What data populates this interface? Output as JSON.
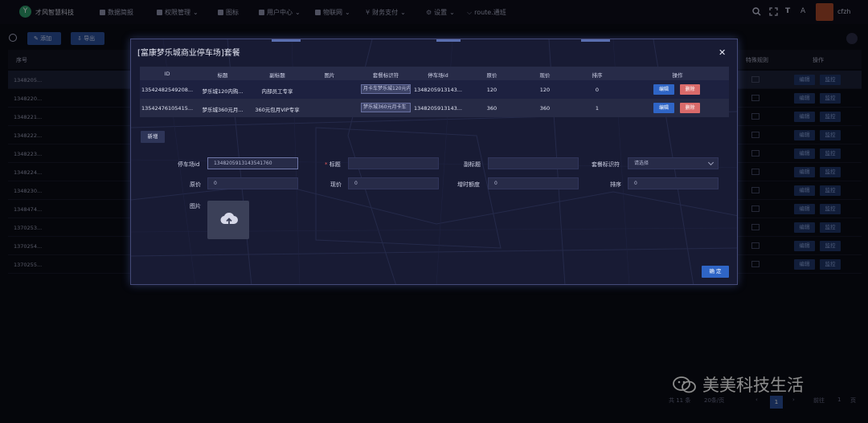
{
  "header": {
    "brand": "才风智慧科技",
    "nav": [
      {
        "label": "数据简报",
        "icon": "dashboard-icon"
      },
      {
        "label": "权限管理",
        "icon": "lock-icon",
        "dropdown": true
      },
      {
        "label": "图标",
        "icon": "image-icon"
      },
      {
        "label": "用户中心",
        "icon": "user-icon",
        "dropdown": true
      },
      {
        "label": "物联网",
        "icon": "iot-icon",
        "dropdown": true
      },
      {
        "label": "财务支付",
        "icon": "yen-icon",
        "dropdown": true
      },
      {
        "label": "设置",
        "icon": "settings-icon",
        "dropdown": true
      },
      {
        "label": "route.通班",
        "icon": "route-icon"
      }
    ],
    "user": "cfzh"
  },
  "background": {
    "toolbar": {
      "add_label": "添加",
      "export_label": "导出"
    },
    "table_headers": {
      "serial": "序号",
      "special_rule": "特殊规则",
      "ops": "操作"
    },
    "row_ids": [
      "1348205...",
      "1348220...",
      "1348221...",
      "1348222...",
      "1348223...",
      "1348224...",
      "1348230...",
      "1348474...",
      "1370253...",
      "1370254...",
      "1370255..."
    ],
    "row_edit": "编辑",
    "row_monitor": "监控",
    "pagination": {
      "total": "共 11 条",
      "page_size": "20条/页",
      "current": "1",
      "goto_label": "前往",
      "goto_value": "1",
      "page_unit": "页"
    }
  },
  "watermark": "美美科技生活",
  "modal": {
    "title": "[富康梦乐城商业停车场]套餐",
    "sub_table": {
      "headers": [
        "ID",
        "标题",
        "副标题",
        "图片",
        "套餐标识符",
        "停车场id",
        "原价",
        "现价",
        "排序",
        "操作"
      ],
      "rows": [
        {
          "id": "13542482549208...",
          "title": "梦乐城120内购...",
          "subtitle": "内部员工专享",
          "image": "",
          "identifier": "月卡车梦乐城120元内部专享",
          "lot_id": "13482059131​43...",
          "original_price": "120",
          "current_price": "120",
          "sort": "0"
        },
        {
          "id": "13542476105415...",
          "title": "梦乐城360元月...",
          "subtitle": "360元包月VIP专享",
          "image": "",
          "identifier": "梦乐城360元月卡车",
          "lot_id": "13482059131​43...",
          "original_price": "360",
          "current_price": "360",
          "sort": "1"
        }
      ],
      "edit_label": "编辑",
      "delete_label": "删除"
    },
    "add_label": "新增",
    "form": {
      "lot_id_label": "停车场id",
      "lot_id_value": "1348205913143541760",
      "title_label": "标题",
      "subtitle_label": "副标题",
      "identifier_label": "套餐标识符",
      "identifier_placeholder": "请选择",
      "original_price_label": "原价",
      "original_price_value": "0",
      "current_price_label": "现价",
      "current_price_value": "0",
      "extra_quota_label": "增时额度",
      "extra_quota_value": "0",
      "sort_label": "排序",
      "sort_value": "0",
      "image_label": "图片"
    },
    "confirm_label": "确 定"
  }
}
